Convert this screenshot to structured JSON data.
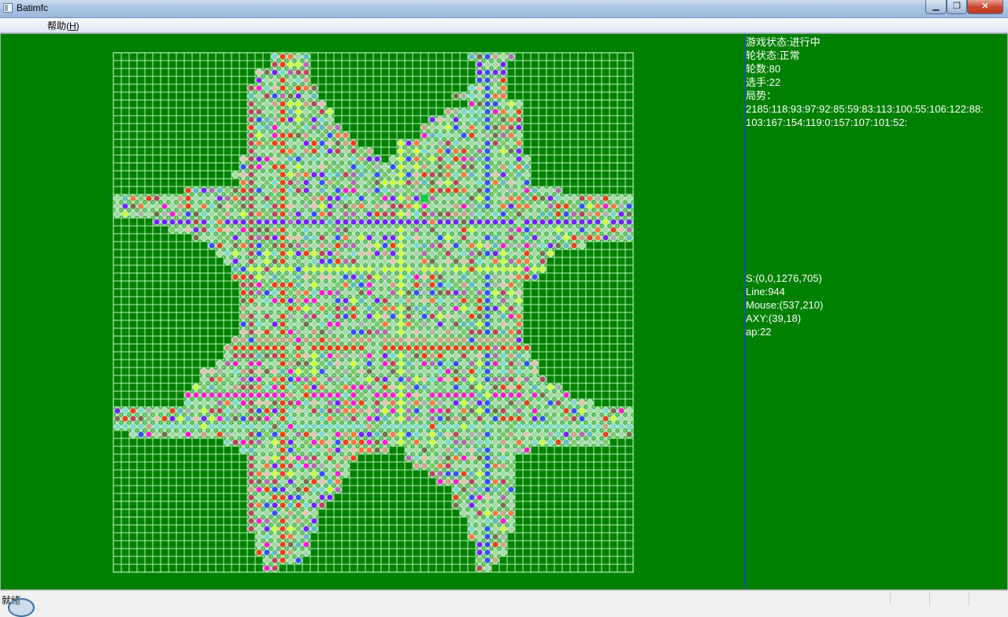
{
  "window": {
    "title": "Batimfc",
    "min_glyph": "▁",
    "max_glyph": "❐",
    "close_glyph": "✕"
  },
  "menu": {
    "help_text": "帮助(",
    "help_key": "H",
    "help_close": ")"
  },
  "info": {
    "game_state": "游戏状态:进行中",
    "round_state": "轮状态:正常",
    "rounds": "轮数:80",
    "player": "选手:22",
    "situation_label": "局势：",
    "situation": "2185:118:93:97:92:85:59:83:113:100:55:106:122:88:103:167:154:119:0:157:107:101:52:"
  },
  "debug": {
    "s": "S:(0,0,1276,705)",
    "line": "Line:944",
    "mouse": "Mouse:(537,210)",
    "axy": "AXY:(39,18)",
    "ap": "ap:22"
  },
  "status": {
    "text": "就绪"
  },
  "colors": {
    "background": "#008000",
    "grid": "#b9f5b9",
    "highlight": "#00cc44",
    "pieces": [
      "#f23d1a",
      "#c0415f",
      "#a8d8a8",
      "#d4a088",
      "#7fd8d0",
      "#d0ff3a",
      "#7a1fff",
      "#3a4cff",
      "#ff1ad0",
      "#b0b0b0",
      "#ff7744",
      "#66b8c8",
      "#7c6a50",
      "#b46ab0",
      "#7fc86e",
      "#e8c0b0"
    ]
  },
  "board": {
    "cols": 66,
    "rows": 66,
    "highlight_cell": [
      39,
      18
    ],
    "row_spans": [
      [
        [
          20,
          24
        ],
        [
          45,
          50
        ]
      ],
      [
        [
          20,
          24
        ],
        [
          46,
          49
        ]
      ],
      [
        [
          18,
          19
        ],
        [
          20,
          24
        ],
        [
          46,
          49
        ]
      ],
      [
        [
          18,
          19
        ],
        [
          20,
          24
        ],
        [
          46,
          49
        ]
      ],
      [
        [
          17,
          25
        ],
        [
          45,
          49
        ]
      ],
      [
        [
          17,
          25
        ],
        [
          43,
          49
        ]
      ],
      [
        [
          17,
          26
        ],
        [
          45,
          51
        ]
      ],
      [
        [
          17,
          27
        ],
        [
          42,
          51
        ]
      ],
      [
        [
          17,
          27
        ],
        [
          40,
          51
        ]
      ],
      [
        [
          17,
          28
        ],
        [
          39,
          51
        ]
      ],
      [
        [
          17,
          29
        ],
        [
          39,
          51
        ]
      ],
      [
        [
          17,
          30
        ],
        [
          36,
          51
        ]
      ],
      [
        [
          17,
          32
        ],
        [
          36,
          51
        ]
      ],
      [
        [
          16,
          33
        ],
        [
          35,
          52
        ]
      ],
      [
        [
          16,
          34
        ],
        [
          35,
          52
        ]
      ],
      [
        [
          15,
          34
        ],
        [
          35,
          52
        ]
      ],
      [
        [
          16,
          52
        ]
      ],
      [
        [
          9,
          56
        ]
      ],
      [
        [
          0,
          65
        ]
      ],
      [
        [
          0,
          65
        ]
      ],
      [
        [
          0,
          65
        ]
      ],
      [
        [
          5,
          65
        ]
      ],
      [
        [
          7,
          65
        ]
      ],
      [
        [
          10,
          65
        ]
      ],
      [
        [
          12,
          59
        ]
      ],
      [
        [
          13,
          55
        ]
      ],
      [
        [
          14,
          54
        ]
      ],
      [
        [
          15,
          54
        ]
      ],
      [
        [
          15,
          53
        ]
      ],
      [
        [
          16,
          51
        ]
      ],
      [
        [
          16,
          51
        ]
      ],
      [
        [
          16,
          51
        ]
      ],
      [
        [
          16,
          51
        ]
      ],
      [
        [
          16,
          51
        ]
      ],
      [
        [
          16,
          51
        ]
      ],
      [
        [
          16,
          51
        ]
      ],
      [
        [
          15,
          51
        ]
      ],
      [
        [
          14,
          52
        ]
      ],
      [
        [
          14,
          52
        ]
      ],
      [
        [
          13,
          53
        ]
      ],
      [
        [
          11,
          53
        ]
      ],
      [
        [
          11,
          54
        ]
      ],
      [
        [
          10,
          56
        ]
      ],
      [
        [
          9,
          57
        ]
      ],
      [
        [
          9,
          60
        ]
      ],
      [
        [
          0,
          65
        ]
      ],
      [
        [
          0,
          65
        ]
      ],
      [
        [
          0,
          65
        ]
      ],
      [
        [
          2,
          65
        ]
      ],
      [
        [
          14,
          62
        ]
      ],
      [
        [
          16,
          32
        ],
        [
          33,
          34
        ],
        [
          37,
          52
        ]
      ],
      [
        [
          17,
          30
        ],
        [
          37,
          50
        ]
      ],
      [
        [
          17,
          29
        ],
        [
          38,
          50
        ]
      ],
      [
        [
          17,
          29
        ],
        [
          40,
          50
        ]
      ],
      [
        [
          17,
          28
        ],
        [
          41,
          50
        ]
      ],
      [
        [
          17,
          28
        ],
        [
          43,
          50
        ]
      ],
      [
        [
          17,
          27
        ],
        [
          43,
          50
        ]
      ],
      [
        [
          17,
          26
        ],
        [
          43,
          50
        ]
      ],
      [
        [
          17,
          25
        ],
        [
          44,
          50
        ]
      ],
      [
        [
          17,
          25
        ],
        [
          45,
          50
        ]
      ],
      [
        [
          17,
          25
        ],
        [
          45,
          50
        ]
      ],
      [
        [
          18,
          24
        ],
        [
          45,
          49
        ]
      ],
      [
        [
          18,
          24
        ],
        [
          46,
          49
        ]
      ],
      [
        [
          18,
          24
        ],
        [
          46,
          49
        ]
      ],
      [
        [
          19,
          23
        ],
        [
          46,
          48
        ]
      ],
      [
        [
          19,
          20
        ],
        [
          46,
          47
        ]
      ]
    ],
    "vertical_lines": [
      {
        "col": 17,
        "color": "#c0415f"
      },
      {
        "col": 21,
        "color": "#f23d1a"
      },
      {
        "col": 36,
        "color": "#d0ff3a"
      },
      {
        "col": 47,
        "color": "#3a4cff"
      }
    ],
    "horizontal_lines": [
      {
        "row": 21,
        "color": "#7a1fff"
      },
      {
        "row": 27,
        "color": "#d0ff3a"
      },
      {
        "row": 36,
        "color": "#d4a088"
      },
      {
        "row": 37,
        "color": "#f23d1a"
      },
      {
        "row": 43,
        "color": "#ff1ad0"
      },
      {
        "row": 47,
        "color": "#7fd8d0"
      }
    ]
  }
}
